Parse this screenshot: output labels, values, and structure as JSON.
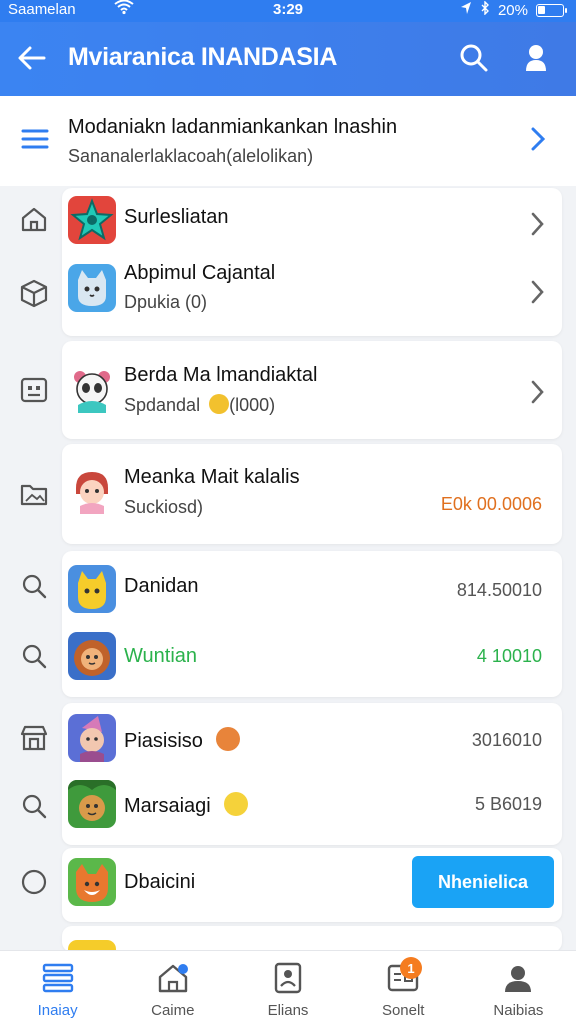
{
  "status_bar": {
    "carrier": "Saamelan",
    "time": "3:29",
    "battery": "20%"
  },
  "app_bar": {
    "title": "Mviaranica INANDASIA",
    "icons": [
      "back-arrow-icon",
      "search-icon",
      "user-icon"
    ]
  },
  "header": {
    "title": "Modaniakn ladanmiankankan lnashin",
    "subtitle": "Sananalerlaklacoah(alelolikan)"
  },
  "rows": [
    {
      "title": "Surlesliatan",
      "subtitle": "",
      "value": "",
      "left_icon": "house-icon",
      "avatar": "star-app-icon"
    },
    {
      "title": "Abpimul Cajantal",
      "subtitle": "Dpukia (0)",
      "value": "",
      "left_icon": "box-icon",
      "avatar": "cat-app-icon"
    },
    {
      "title": "Berda Ma lmandiaktal",
      "subtitle": "Spdandal",
      "subtitle_extra": "(l000)",
      "value": "",
      "left_icon": "id-card-icon",
      "avatar": "panda-icon"
    },
    {
      "title": "Meanka Mait kalalis",
      "subtitle": "Suckiosd)",
      "value": "E0k 00.0006",
      "left_icon": "folder-image-icon",
      "avatar": "doll-icon"
    },
    {
      "title": "Danidan",
      "subtitle": "",
      "value": "814.50010",
      "left_icon": "search-icon",
      "avatar": "yellow-cat-icon"
    },
    {
      "title": "Wuntian",
      "subtitle": "",
      "value": "4 10010",
      "left_icon": "search-icon",
      "avatar": "lion-icon"
    },
    {
      "title": "Piasisiso",
      "subtitle": "",
      "value": "3016010",
      "left_icon": "store-icon",
      "avatar": "girl-avatar-icon"
    },
    {
      "title": "Marsaiagi",
      "subtitle": "",
      "value": "5 B6019",
      "left_icon": "search-icon",
      "avatar": "jungle-icon"
    },
    {
      "title": "Dbaicini",
      "subtitle": "",
      "value": "",
      "left_icon": "circle-icon",
      "avatar": "fox-icon"
    }
  ],
  "cta": {
    "label": "Nhenielica"
  },
  "colors": {
    "primary": "#2f7df0",
    "accent_orange": "#e0701f",
    "accent_green": "#2bb24c",
    "cta": "#1aa3f5"
  },
  "bottom_nav": [
    {
      "label": "Inaiay",
      "icon": "list-icon",
      "active": true
    },
    {
      "label": "Caime",
      "icon": "home-icon",
      "active": false
    },
    {
      "label": "Elians",
      "icon": "contact-card-icon",
      "active": false
    },
    {
      "label": "Sonelt",
      "icon": "message-icon",
      "active": false,
      "badge": "1"
    },
    {
      "label": "Naibias",
      "icon": "profile-icon",
      "active": false
    }
  ]
}
